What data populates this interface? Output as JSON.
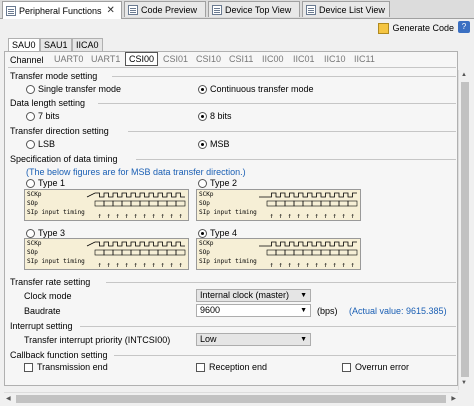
{
  "top_tabs": [
    {
      "label": "Peripheral Functions",
      "active": true
    },
    {
      "label": "Code Preview",
      "active": false
    },
    {
      "label": "Device Top View",
      "active": false
    },
    {
      "label": "Device List View",
      "active": false
    }
  ],
  "toolbar": {
    "generate_label": "Generate Code"
  },
  "unit_tabs": [
    "SAU0",
    "SAU1",
    "IICA0"
  ],
  "channel": {
    "label": "Channel",
    "tabs": [
      "UART0",
      "UART1",
      "CSI00",
      "CSI01",
      "CSI10",
      "CSI11",
      "IIC00",
      "IIC01",
      "IIC10",
      "IIC11"
    ],
    "active": "CSI00"
  },
  "transfer_mode": {
    "title": "Transfer mode setting",
    "single": "Single transfer mode",
    "continuous": "Continuous transfer mode",
    "selected": "continuous"
  },
  "data_length": {
    "title": "Data length setting",
    "opt7": "7 bits",
    "opt8": "8 bits",
    "selected": "8"
  },
  "direction": {
    "title": "Transfer direction setting",
    "lsb": "LSB",
    "msb": "MSB",
    "selected": "MSB"
  },
  "timing": {
    "title": "Specification of data timing",
    "note": "(The below figures are for MSB data transfer direction.)",
    "types": [
      "Type 1",
      "Type 2",
      "Type 3",
      "Type 4"
    ],
    "selected": "Type 4",
    "sig_sck": "SCKp",
    "sig_so": "SOp",
    "sig_si": "SIp input timing"
  },
  "rate": {
    "title": "Transfer rate setting",
    "clock_label": "Clock mode",
    "clock_value": "Internal clock (master)",
    "baud_label": "Baudrate",
    "baud_value": "9600",
    "baud_unit": "(bps)",
    "actual": "(Actual value: 9615.385)"
  },
  "interrupt": {
    "title": "Interrupt setting",
    "priority_label": "Transfer interrupt priority (INTCSI00)",
    "priority_value": "Low"
  },
  "callback": {
    "title": "Callback function setting",
    "transmission_end": "Transmission end",
    "reception_end": "Reception end",
    "overrun_error": "Overrun error"
  },
  "colors": {
    "accent": "#1a5fb4",
    "diagram_bg": "#f6efd6"
  }
}
